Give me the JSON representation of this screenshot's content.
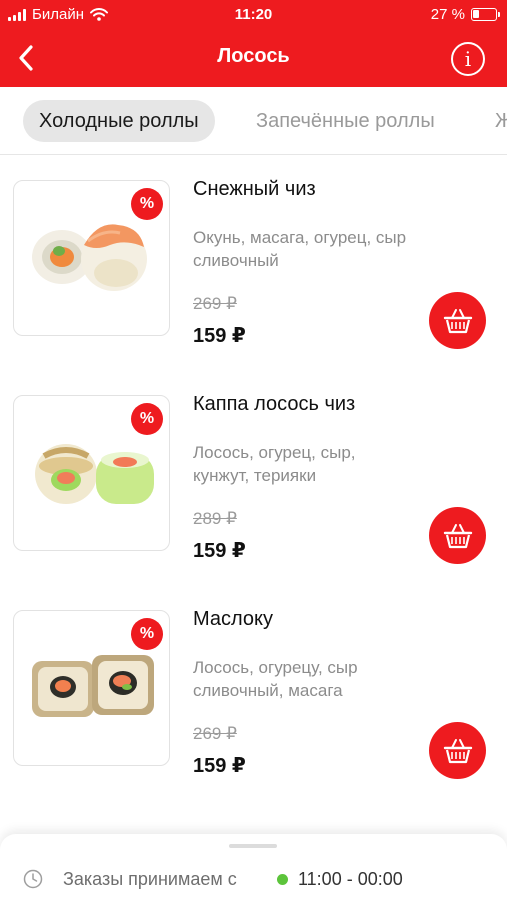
{
  "status_bar": {
    "carrier": "Билайн",
    "time": "11:20",
    "battery": "27 %",
    "battery_level": 0.27
  },
  "nav": {
    "title": "Лосось",
    "back_icon": "chevron-left-icon",
    "info_icon": "info-icon",
    "info_glyph": "i"
  },
  "tabs": [
    {
      "label": "Холодные роллы",
      "active": true
    },
    {
      "label": "Запечённые роллы",
      "active": false
    },
    {
      "label": "Ж",
      "active": false
    }
  ],
  "products": [
    {
      "name": "Снежный чиз",
      "description": "Окунь, масага, огурец, сыр сливочный",
      "old_price": "269 ₽",
      "price": "159 ₽",
      "badge": "%"
    },
    {
      "name": "Каппа лосось чиз",
      "description": "Лосось, огурец, сыр, кунжут, терияки",
      "old_price": "289 ₽",
      "price": "159 ₽",
      "badge": "%"
    },
    {
      "name": "Маслоку",
      "description": "Лосось, огурецу, сыр сливочный, масага",
      "old_price": "269 ₽",
      "price": "159 ₽",
      "badge": "%"
    }
  ],
  "footer": {
    "label": "Заказы принимаем с",
    "hours": "11:00 - 00:00",
    "status_color": "#5cc43b"
  },
  "colors": {
    "accent": "#ee1b1f"
  }
}
